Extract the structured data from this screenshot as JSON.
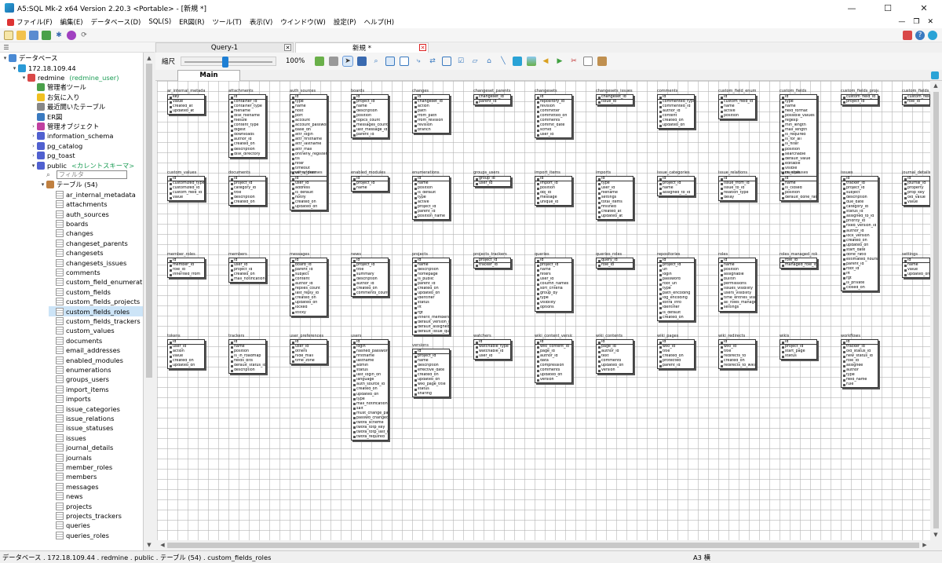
{
  "window": {
    "title": "A5:SQL Mk-2 x64 Version 2.20.3 <Portable> - [新規 *]",
    "controls": [
      "—",
      "☐",
      "✕"
    ]
  },
  "menu": {
    "items": [
      "ファイル(F)",
      "編集(E)",
      "データベース(D)",
      "SQL(S)",
      "ER図(R)",
      "ツール(T)",
      "表示(V)",
      "ウインドウ(W)",
      "設定(P)",
      "ヘルプ(H)"
    ],
    "mdi_controls": [
      "—",
      "❐",
      "✕"
    ]
  },
  "tabs": {
    "query": "Query-1",
    "er": "新規 *"
  },
  "er_toolbar": {
    "zoom_label": "縮尺",
    "zoom_value": "100%",
    "zoom_fraction": 0.47
  },
  "main_tab": "Main",
  "tree": {
    "filter_placeholder": "フィルタ",
    "rows": [
      {
        "level": 0,
        "exp": "v",
        "text": "データベース",
        "icon": "database-icon",
        "color": "#4a8ad4"
      },
      {
        "level": 1,
        "exp": "v",
        "text": "172.18.109.44",
        "icon": "server-icon",
        "color": "#2a9ad6"
      },
      {
        "level": 2,
        "exp": "v",
        "text": "redmine",
        "sub": "(redmine_user)",
        "icon": "db-connection-icon",
        "color": "#d94848"
      },
      {
        "level": 3,
        "exp": "",
        "text": "管理者ツール",
        "icon": "admin-tools-icon",
        "color": "#4aa04a"
      },
      {
        "level": 3,
        "exp": "",
        "text": "お気に入り",
        "icon": "star-icon",
        "color": "#f0c020"
      },
      {
        "level": 3,
        "exp": "",
        "text": "最近開いたテーブル",
        "icon": "recent-icon",
        "color": "#888888"
      },
      {
        "level": 3,
        "exp": "",
        "text": "ER図",
        "icon": "er-diagram-icon",
        "color": "#3a7ac0"
      },
      {
        "level": 3,
        "exp": ">",
        "text": "管理オブジェクト",
        "icon": "objects-icon",
        "color": "#c040a0"
      },
      {
        "level": 3,
        "exp": ">",
        "text": "information_schema",
        "icon": "schema-icon",
        "color": "#5060d0"
      },
      {
        "level": 3,
        "exp": ">",
        "text": "pg_catalog",
        "icon": "schema-icon",
        "color": "#5060d0"
      },
      {
        "level": 3,
        "exp": ">",
        "text": "pg_toast",
        "icon": "schema-icon",
        "color": "#5060d0"
      },
      {
        "level": 3,
        "exp": "v",
        "text": "public",
        "sub": "<カレントスキーマ>",
        "icon": "schema-icon",
        "color": "#5060d0"
      },
      {
        "level": 4,
        "exp": "",
        "text": "",
        "filter": true,
        "icon": "search-icon",
        "color": "#666666"
      },
      {
        "level": 4,
        "exp": "v",
        "text": "テーブル (54)",
        "icon": "table-folder-icon",
        "color": "#c08040"
      },
      {
        "level": 5,
        "exp": "",
        "text": "ar_internal_metadata",
        "icon": "table-icon",
        "color": "#999999"
      },
      {
        "level": 5,
        "exp": "",
        "text": "attachments",
        "icon": "table-icon",
        "color": "#999999"
      },
      {
        "level": 5,
        "exp": "",
        "text": "auth_sources",
        "icon": "table-icon",
        "color": "#999999"
      },
      {
        "level": 5,
        "exp": "",
        "text": "boards",
        "icon": "table-icon",
        "color": "#999999"
      },
      {
        "level": 5,
        "exp": "",
        "text": "changes",
        "icon": "table-icon",
        "color": "#999999"
      },
      {
        "level": 5,
        "exp": "",
        "text": "changeset_parents",
        "icon": "table-icon",
        "color": "#999999"
      },
      {
        "level": 5,
        "exp": "",
        "text": "changesets",
        "icon": "table-icon",
        "color": "#999999"
      },
      {
        "level": 5,
        "exp": "",
        "text": "changesets_issues",
        "icon": "table-icon",
        "color": "#999999"
      },
      {
        "level": 5,
        "exp": "",
        "text": "comments",
        "icon": "table-icon",
        "color": "#999999"
      },
      {
        "level": 5,
        "exp": "",
        "text": "custom_field_enumerati",
        "icon": "table-icon",
        "color": "#999999"
      },
      {
        "level": 5,
        "exp": "",
        "text": "custom_fields",
        "icon": "table-icon",
        "color": "#999999"
      },
      {
        "level": 5,
        "exp": "",
        "text": "custom_fields_projects",
        "icon": "table-icon",
        "color": "#999999"
      },
      {
        "level": 5,
        "exp": "",
        "text": "custom_fields_roles",
        "icon": "table-icon",
        "color": "#999999",
        "selected": true
      },
      {
        "level": 5,
        "exp": "",
        "text": "custom_fields_trackers",
        "icon": "table-icon",
        "color": "#999999"
      },
      {
        "level": 5,
        "exp": "",
        "text": "custom_values",
        "icon": "table-icon",
        "color": "#999999"
      },
      {
        "level": 5,
        "exp": "",
        "text": "documents",
        "icon": "table-icon",
        "color": "#999999"
      },
      {
        "level": 5,
        "exp": "",
        "text": "email_addresses",
        "icon": "table-icon",
        "color": "#999999"
      },
      {
        "level": 5,
        "exp": "",
        "text": "enabled_modules",
        "icon": "table-icon",
        "color": "#999999"
      },
      {
        "level": 5,
        "exp": "",
        "text": "enumerations",
        "icon": "table-icon",
        "color": "#999999"
      },
      {
        "level": 5,
        "exp": "",
        "text": "groups_users",
        "icon": "table-icon",
        "color": "#999999"
      },
      {
        "level": 5,
        "exp": "",
        "text": "import_items",
        "icon": "table-icon",
        "color": "#999999"
      },
      {
        "level": 5,
        "exp": "",
        "text": "imports",
        "icon": "table-icon",
        "color": "#999999"
      },
      {
        "level": 5,
        "exp": "",
        "text": "issue_categories",
        "icon": "table-icon",
        "color": "#999999"
      },
      {
        "level": 5,
        "exp": "",
        "text": "issue_relations",
        "icon": "table-icon",
        "color": "#999999"
      },
      {
        "level": 5,
        "exp": "",
        "text": "issue_statuses",
        "icon": "table-icon",
        "color": "#999999"
      },
      {
        "level": 5,
        "exp": "",
        "text": "issues",
        "icon": "table-icon",
        "color": "#999999"
      },
      {
        "level": 5,
        "exp": "",
        "text": "journal_details",
        "icon": "table-icon",
        "color": "#999999"
      },
      {
        "level": 5,
        "exp": "",
        "text": "journals",
        "icon": "table-icon",
        "color": "#999999"
      },
      {
        "level": 5,
        "exp": "",
        "text": "member_roles",
        "icon": "table-icon",
        "color": "#999999"
      },
      {
        "level": 5,
        "exp": "",
        "text": "members",
        "icon": "table-icon",
        "color": "#999999"
      },
      {
        "level": 5,
        "exp": "",
        "text": "messages",
        "icon": "table-icon",
        "color": "#999999"
      },
      {
        "level": 5,
        "exp": "",
        "text": "news",
        "icon": "table-icon",
        "color": "#999999"
      },
      {
        "level": 5,
        "exp": "",
        "text": "projects",
        "icon": "table-icon",
        "color": "#999999"
      },
      {
        "level": 5,
        "exp": "",
        "text": "projects_trackers",
        "icon": "table-icon",
        "color": "#999999"
      },
      {
        "level": 5,
        "exp": "",
        "text": "queries",
        "icon": "table-icon",
        "color": "#999999"
      },
      {
        "level": 5,
        "exp": "",
        "text": "queries_roles",
        "icon": "table-icon",
        "color": "#999999"
      }
    ]
  },
  "er_entities": [
    {
      "name": "ar_internal_metadata",
      "cols": [
        "key",
        "value",
        "created_at",
        "updated_at"
      ]
    },
    {
      "name": "attachments",
      "cols": [
        "id",
        "container_id",
        "container_type",
        "filename",
        "disk_filename",
        "filesize",
        "content_type",
        "digest",
        "downloads",
        "author_id",
        "created_on",
        "description",
        "disk_directory"
      ]
    },
    {
      "name": "auth_sources",
      "cols": [
        "id",
        "type",
        "name",
        "host",
        "port",
        "account",
        "account_password",
        "base_dn",
        "attr_login",
        "attr_firstname",
        "attr_lastname",
        "attr_mail",
        "onthefly_register",
        "tls",
        "filter",
        "timeout",
        "verify_peer"
      ]
    },
    {
      "name": "boards",
      "cols": [
        "id",
        "project_id",
        "name",
        "description",
        "position",
        "topics_count",
        "messages_count",
        "last_message_id",
        "parent_id"
      ]
    },
    {
      "name": "changes",
      "cols": [
        "id",
        "changeset_id",
        "action",
        "path",
        "from_path",
        "from_revision",
        "revision",
        "branch"
      ]
    },
    {
      "name": "changeset_parents",
      "cols": [
        "changeset_id",
        "parent_id"
      ]
    },
    {
      "name": "changesets",
      "cols": [
        "id",
        "repository_id",
        "revision",
        "committer",
        "committed_on",
        "comments",
        "commit_date",
        "scmid",
        "user_id"
      ]
    },
    {
      "name": "changesets_issues",
      "cols": [
        "changeset_id",
        "issue_id"
      ]
    },
    {
      "name": "comments",
      "cols": [
        "id",
        "commented_type",
        "commented_id",
        "author_id",
        "content",
        "created_on",
        "updated_on"
      ]
    },
    {
      "name": "custom_field_enumerations",
      "cols": [
        "id",
        "custom_field_id",
        "name",
        "active",
        "position"
      ]
    },
    {
      "name": "custom_fields",
      "cols": [
        "id",
        "type",
        "name",
        "field_format",
        "possible_values",
        "regexp",
        "min_length",
        "max_length",
        "is_required",
        "is_for_all",
        "is_filter",
        "position",
        "searchable",
        "default_value",
        "editable",
        "visible",
        "multiple",
        "format_store",
        "description"
      ]
    },
    {
      "name": "custom_fields_projects",
      "cols": [
        "custom_field_id",
        "project_id"
      ]
    },
    {
      "name": "custom_fields_",
      "cols": [
        "custom_field_id",
        "role_id"
      ]
    },
    {
      "name": "custom_values",
      "cols": [
        "id",
        "customized_type",
        "customized_id",
        "custom_field_id",
        "value"
      ]
    },
    {
      "name": "documents",
      "cols": [
        "id",
        "project_id",
        "category_id",
        "title",
        "description",
        "created_on"
      ]
    },
    {
      "name": "email_addresses",
      "cols": [
        "id",
        "user_id",
        "address",
        "is_default",
        "notify",
        "created_on",
        "updated_on"
      ]
    },
    {
      "name": "enabled_modules",
      "cols": [
        "id",
        "project_id",
        "name"
      ]
    },
    {
      "name": "enumerations",
      "cols": [
        "id",
        "name",
        "position",
        "is_default",
        "type",
        "active",
        "project_id",
        "parent_id",
        "position_name"
      ]
    },
    {
      "name": "groups_users",
      "cols": [
        "group_id",
        "user_id"
      ]
    },
    {
      "name": "import_items",
      "cols": [
        "id",
        "import_id",
        "position",
        "obj_id",
        "message",
        "unique_id"
      ]
    },
    {
      "name": "imports",
      "cols": [
        "id",
        "type",
        "user_id",
        "filename",
        "settings",
        "total_items",
        "finished",
        "created_at",
        "updated_at"
      ]
    },
    {
      "name": "issue_categories",
      "cols": [
        "id",
        "project_id",
        "name",
        "assigned_to_id"
      ]
    },
    {
      "name": "issue_relations",
      "cols": [
        "id",
        "issue_from_id",
        "issue_to_id",
        "relation_type",
        "delay"
      ]
    },
    {
      "name": "issue_statuses",
      "cols": [
        "id",
        "name",
        "is_closed",
        "position",
        "default_done_ratio"
      ]
    },
    {
      "name": "issues",
      "cols": [
        "id",
        "tracker_id",
        "project_id",
        "subject",
        "description",
        "due_date",
        "category_id",
        "status_id",
        "assigned_to_id",
        "priority_id",
        "fixed_version_id",
        "author_id",
        "lock_version",
        "created_on",
        "updated_on",
        "start_date",
        "done_ratio",
        "estimated_hours",
        "parent_id",
        "root_id",
        "lft",
        "rgt",
        "is_private",
        "closed_on"
      ]
    },
    {
      "name": "journal_details",
      "cols": [
        "id",
        "journal_id",
        "property",
        "prop_key",
        "old_value",
        "value"
      ]
    },
    {
      "name": "member_roles",
      "cols": [
        "id",
        "member_id",
        "role_id",
        "inherited_from"
      ]
    },
    {
      "name": "members",
      "cols": [
        "id",
        "user_id",
        "project_id",
        "created_on",
        "mail_notification"
      ]
    },
    {
      "name": "messages",
      "cols": [
        "id",
        "board_id",
        "parent_id",
        "subject",
        "content",
        "author_id",
        "replies_count",
        "last_reply_id",
        "created_on",
        "updated_on",
        "locked",
        "sticky"
      ]
    },
    {
      "name": "news",
      "cols": [
        "id",
        "project_id",
        "title",
        "summary",
        "description",
        "author_id",
        "created_on",
        "comments_count"
      ]
    },
    {
      "name": "projects",
      "cols": [
        "id",
        "name",
        "description",
        "homepage",
        "is_public",
        "parent_id",
        "created_on",
        "updated_on",
        "identifier",
        "status",
        "lft",
        "rgt",
        "inherit_members",
        "default_version_id",
        "default_assigned_to_id",
        "default_issue_query_id"
      ]
    },
    {
      "name": "projects_trackers",
      "cols": [
        "project_id",
        "tracker_id"
      ]
    },
    {
      "name": "queries",
      "cols": [
        "id",
        "project_id",
        "name",
        "filters",
        "user_id",
        "column_names",
        "sort_criteria",
        "group_by",
        "type",
        "visibility",
        "options"
      ]
    },
    {
      "name": "queries_roles",
      "cols": [
        "query_id",
        "role_id"
      ]
    },
    {
      "name": "repositories",
      "cols": [
        "id",
        "project_id",
        "url",
        "login",
        "password",
        "root_url",
        "type",
        "path_encoding",
        "log_encoding",
        "extra_info",
        "identifier",
        "is_default",
        "created_on"
      ]
    },
    {
      "name": "roles",
      "cols": [
        "id",
        "name",
        "position",
        "assignable",
        "builtin",
        "permissions",
        "issues_visibility",
        "users_visibility",
        "time_entries_visibility",
        "all_roles_managed",
        "settings"
      ]
    },
    {
      "name": "roles_managed_roles",
      "cols": [
        "role_id",
        "managed_role_id"
      ]
    },
    {
      "name": "settings",
      "cols": [
        "id",
        "name",
        "value",
        "updated_on"
      ]
    },
    {
      "name": "tokens",
      "cols": [
        "id",
        "user_id",
        "action",
        "value",
        "created_on",
        "updated_on"
      ]
    },
    {
      "name": "trackers",
      "cols": [
        "id",
        "name",
        "position",
        "is_in_roadmap",
        "fields_bits",
        "default_status_id",
        "description"
      ]
    },
    {
      "name": "user_preferences",
      "cols": [
        "id",
        "user_id",
        "others",
        "hide_mail",
        "time_zone"
      ]
    },
    {
      "name": "users",
      "cols": [
        "id",
        "login",
        "hashed_password",
        "firstname",
        "lastname",
        "admin",
        "status",
        "last_login_on",
        "language",
        "auth_source_id",
        "created_on",
        "updated_on",
        "type",
        "mail_notification",
        "salt",
        "must_change_passwd",
        "passwd_changed_on",
        "twofa_scheme",
        "twofa_totp_key",
        "twofa_totp_last_used_at",
        "twofa_required"
      ]
    },
    {
      "name": "versions",
      "cols": [
        "id",
        "project_id",
        "name",
        "description",
        "effective_date",
        "created_on",
        "updated_on",
        "wiki_page_title",
        "status",
        "sharing"
      ]
    },
    {
      "name": "watchers",
      "cols": [
        "id",
        "watchable_type",
        "watchable_id",
        "user_id"
      ]
    },
    {
      "name": "wiki_content_versions",
      "cols": [
        "id",
        "wiki_content_id",
        "page_id",
        "author_id",
        "data",
        "compression",
        "comments",
        "updated_on",
        "version"
      ]
    },
    {
      "name": "wiki_contents",
      "cols": [
        "id",
        "page_id",
        "author_id",
        "text",
        "comments",
        "updated_on",
        "version"
      ]
    },
    {
      "name": "wiki_pages",
      "cols": [
        "id",
        "wiki_id",
        "title",
        "created_on",
        "protected",
        "parent_id"
      ]
    },
    {
      "name": "wiki_redirects",
      "cols": [
        "id",
        "wiki_id",
        "title",
        "redirects_to",
        "created_on",
        "redirects_to_wiki_id"
      ]
    },
    {
      "name": "wikis",
      "cols": [
        "id",
        "project_id",
        "start_page",
        "status"
      ]
    },
    {
      "name": "workflows",
      "cols": [
        "id",
        "tracker_id",
        "old_status_id",
        "new_status_id",
        "role_id",
        "assignee",
        "author",
        "type",
        "field_name",
        "rule"
      ]
    }
  ],
  "status": {
    "path": "データベース . 172.18.109.44 . redmine . public . テーブル (54) . custom_fields_roles",
    "paper": "A3 横"
  }
}
